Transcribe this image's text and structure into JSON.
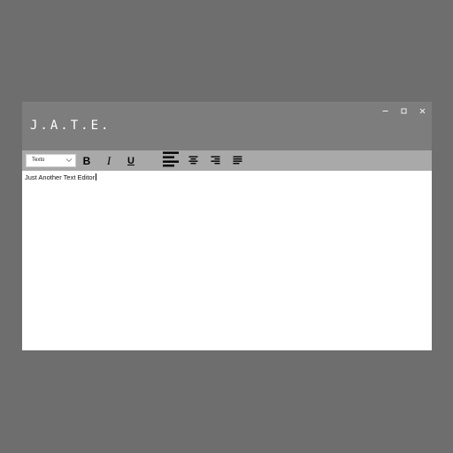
{
  "window": {
    "app_title": "J.A.T.E.",
    "controls": [
      "minimize-icon",
      "maximize-icon",
      "close-icon"
    ]
  },
  "toolbar": {
    "font_select": {
      "value": "Texto",
      "icon": "chevron-down-icon"
    },
    "bold_label": "B",
    "italic_label": "I",
    "underline_label": "U",
    "align_buttons": [
      "align-left-icon",
      "align-center-icon",
      "align-right-icon",
      "align-justify-icon"
    ],
    "active_align": "align-left-icon"
  },
  "editor": {
    "text": "Just Another Text Editor"
  },
  "colors": {
    "background": "#6e6e6e",
    "titlebar": "#7d7d7d",
    "toolbar": "#a9a9a9",
    "editor": "#ffffff"
  }
}
